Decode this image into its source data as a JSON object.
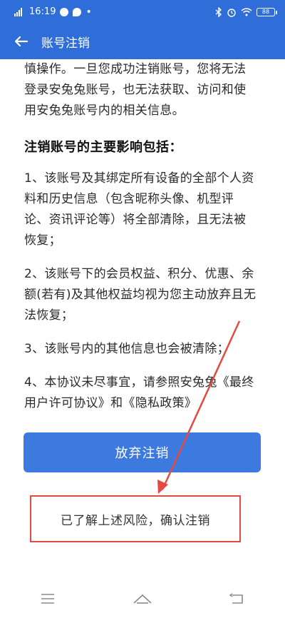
{
  "status_bar": {
    "signal_text": "4G",
    "time": "16:19",
    "battery_label": "88"
  },
  "header": {
    "title": "账号注销"
  },
  "content": {
    "intro_lines": [
      "慎操作。一旦您成功注销账号，您将无法",
      "登录安兔兔账号，也无法获取、访问和使",
      "用安兔兔账号内的相关信息。"
    ],
    "section_title": "注销账号的主要影响包括：",
    "items": [
      {
        "lines": [
          "1、该账号及其绑定所有设备的全部个人资",
          "料和历史信息（包含昵称头像、机型评",
          "论、资讯评论等）将全部清除，且无法被",
          "恢复；"
        ]
      },
      {
        "lines": [
          "2、该账号下的会员权益、积分、优惠、余",
          "额(若有)及其他权益均视为您主动放弃且无",
          "法恢复；"
        ]
      },
      {
        "lines": [
          "3、该账号内的其他信息也会被清除；"
        ]
      },
      {
        "lines": [
          "4、本协议未尽事宜，请参照安兔兔《最终",
          "用户许可协议》和《隐私政策》"
        ]
      }
    ]
  },
  "actions": {
    "abandon_label": "放弃注销",
    "confirm_label": "已了解上述风险，确认注销"
  },
  "colors": {
    "brand": "#2f6ed8",
    "primary_button": "#3c7ae0",
    "annotation": "#e24a42"
  },
  "nav": {
    "icons": [
      "menu-icon",
      "home-icon",
      "back-nav-icon"
    ]
  }
}
